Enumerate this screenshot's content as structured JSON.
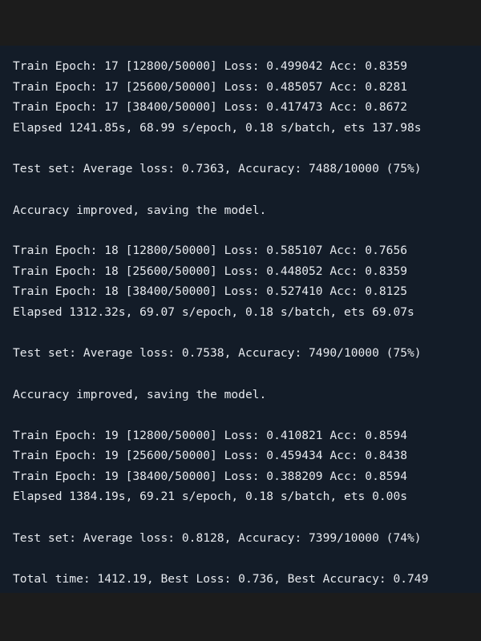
{
  "terminal": {
    "lines": [
      "Train Epoch: 17 [12800/50000] Loss: 0.499042 Acc: 0.8359",
      "Train Epoch: 17 [25600/50000] Loss: 0.485057 Acc: 0.8281",
      "Train Epoch: 17 [38400/50000] Loss: 0.417473 Acc: 0.8672",
      "Elapsed 1241.85s, 68.99 s/epoch, 0.18 s/batch, ets 137.98s",
      "Test set: Average loss: 0.7363, Accuracy: 7488/10000 (75%)",
      "Accuracy improved, saving the model.",
      "Train Epoch: 18 [12800/50000] Loss: 0.585107 Acc: 0.7656",
      "Train Epoch: 18 [25600/50000] Loss: 0.448052 Acc: 0.8359",
      "Train Epoch: 18 [38400/50000] Loss: 0.527410 Acc: 0.8125",
      "Elapsed 1312.32s, 69.07 s/epoch, 0.18 s/batch, ets 69.07s",
      "Test set: Average loss: 0.7538, Accuracy: 7490/10000 (75%)",
      "Accuracy improved, saving the model.",
      "Train Epoch: 19 [12800/50000] Loss: 0.410821 Acc: 0.8594",
      "Train Epoch: 19 [25600/50000] Loss: 0.459434 Acc: 0.8438",
      "Train Epoch: 19 [38400/50000] Loss: 0.388209 Acc: 0.8594",
      "Elapsed 1384.19s, 69.21 s/epoch, 0.18 s/batch, ets 0.00s",
      "Test set: Average loss: 0.8128, Accuracy: 7399/10000 (74%)",
      "Total time: 1412.19, Best Loss: 0.736, Best Accuracy: 0.749"
    ]
  }
}
